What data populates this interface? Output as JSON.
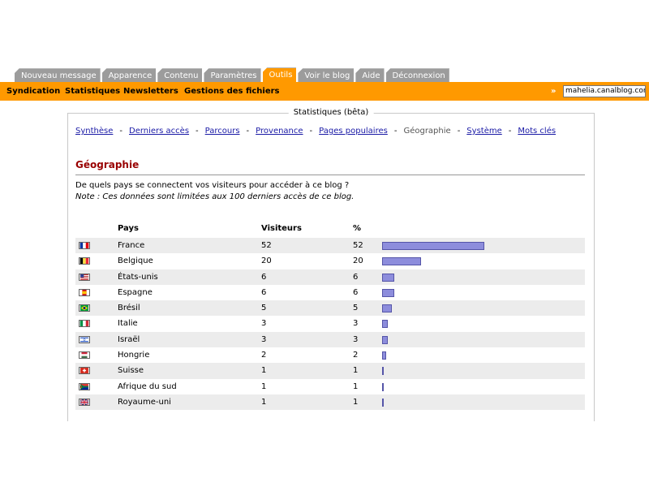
{
  "tabs": [
    {
      "label": "Nouveau message",
      "active": false
    },
    {
      "label": "Apparence",
      "active": false
    },
    {
      "label": "Contenu",
      "active": false
    },
    {
      "label": "Paramètres",
      "active": false
    },
    {
      "label": "Outils",
      "active": true
    },
    {
      "label": "Voir le blog",
      "active": false
    },
    {
      "label": "Aide",
      "active": false
    },
    {
      "label": "Déconnexion",
      "active": false
    }
  ],
  "subnav": {
    "syndication": "Syndication",
    "statistiques": "Statistiques",
    "newsletters": "Newsletters",
    "fichiers": "Gestions des fichiers",
    "arrows": "»",
    "blog_url": "mahelia.canalblog.com"
  },
  "panel": {
    "title": "Statistiques (bêta)",
    "nav": {
      "synthese": "Synthèse",
      "derniers": "Derniers accès",
      "parcours": "Parcours",
      "provenance": "Provenance",
      "pages": "Pages populaires",
      "geographie": "Géographie",
      "systeme": "Système",
      "mots": "Mots clés",
      "sep": "-"
    },
    "section_title": "Géographie",
    "question": "De quels pays se connectent vos visiteurs pour accéder à ce blog ?",
    "note": "Note : Ces données sont limitées aux 100 derniers accès de ce blog."
  },
  "table": {
    "headers": {
      "pays": "Pays",
      "visiteurs": "Visiteurs",
      "pct": "%"
    },
    "rows": [
      {
        "flag": "france-flag",
        "pays": "France",
        "visiteurs": "52",
        "pct": "52"
      },
      {
        "flag": "belgium-flag",
        "pays": "Belgique",
        "visiteurs": "20",
        "pct": "20"
      },
      {
        "flag": "usa-flag",
        "pays": "États-unis",
        "visiteurs": "6",
        "pct": "6"
      },
      {
        "flag": "spain-flag",
        "pays": "Espagne",
        "visiteurs": "6",
        "pct": "6"
      },
      {
        "flag": "brazil-flag",
        "pays": "Brésil",
        "visiteurs": "5",
        "pct": "5"
      },
      {
        "flag": "italy-flag",
        "pays": "Italie",
        "visiteurs": "3",
        "pct": "3"
      },
      {
        "flag": "israel-flag",
        "pays": "Israël",
        "visiteurs": "3",
        "pct": "3"
      },
      {
        "flag": "hungary-flag",
        "pays": "Hongrie",
        "visiteurs": "2",
        "pct": "2"
      },
      {
        "flag": "switzerland-flag",
        "pays": "Suisse",
        "visiteurs": "1",
        "pct": "1"
      },
      {
        "flag": "south-africa-flag",
        "pays": "Afrique du sud",
        "visiteurs": "1",
        "pct": "1"
      },
      {
        "flag": "uk-flag",
        "pays": "Royaume-uni",
        "visiteurs": "1",
        "pct": "1"
      }
    ]
  },
  "colors": {
    "accent": "#ff9900",
    "tab_inactive": "#9c9c9c",
    "title_red": "#990000",
    "bar": "#8d8ddc",
    "link": "#1a1aa6"
  }
}
